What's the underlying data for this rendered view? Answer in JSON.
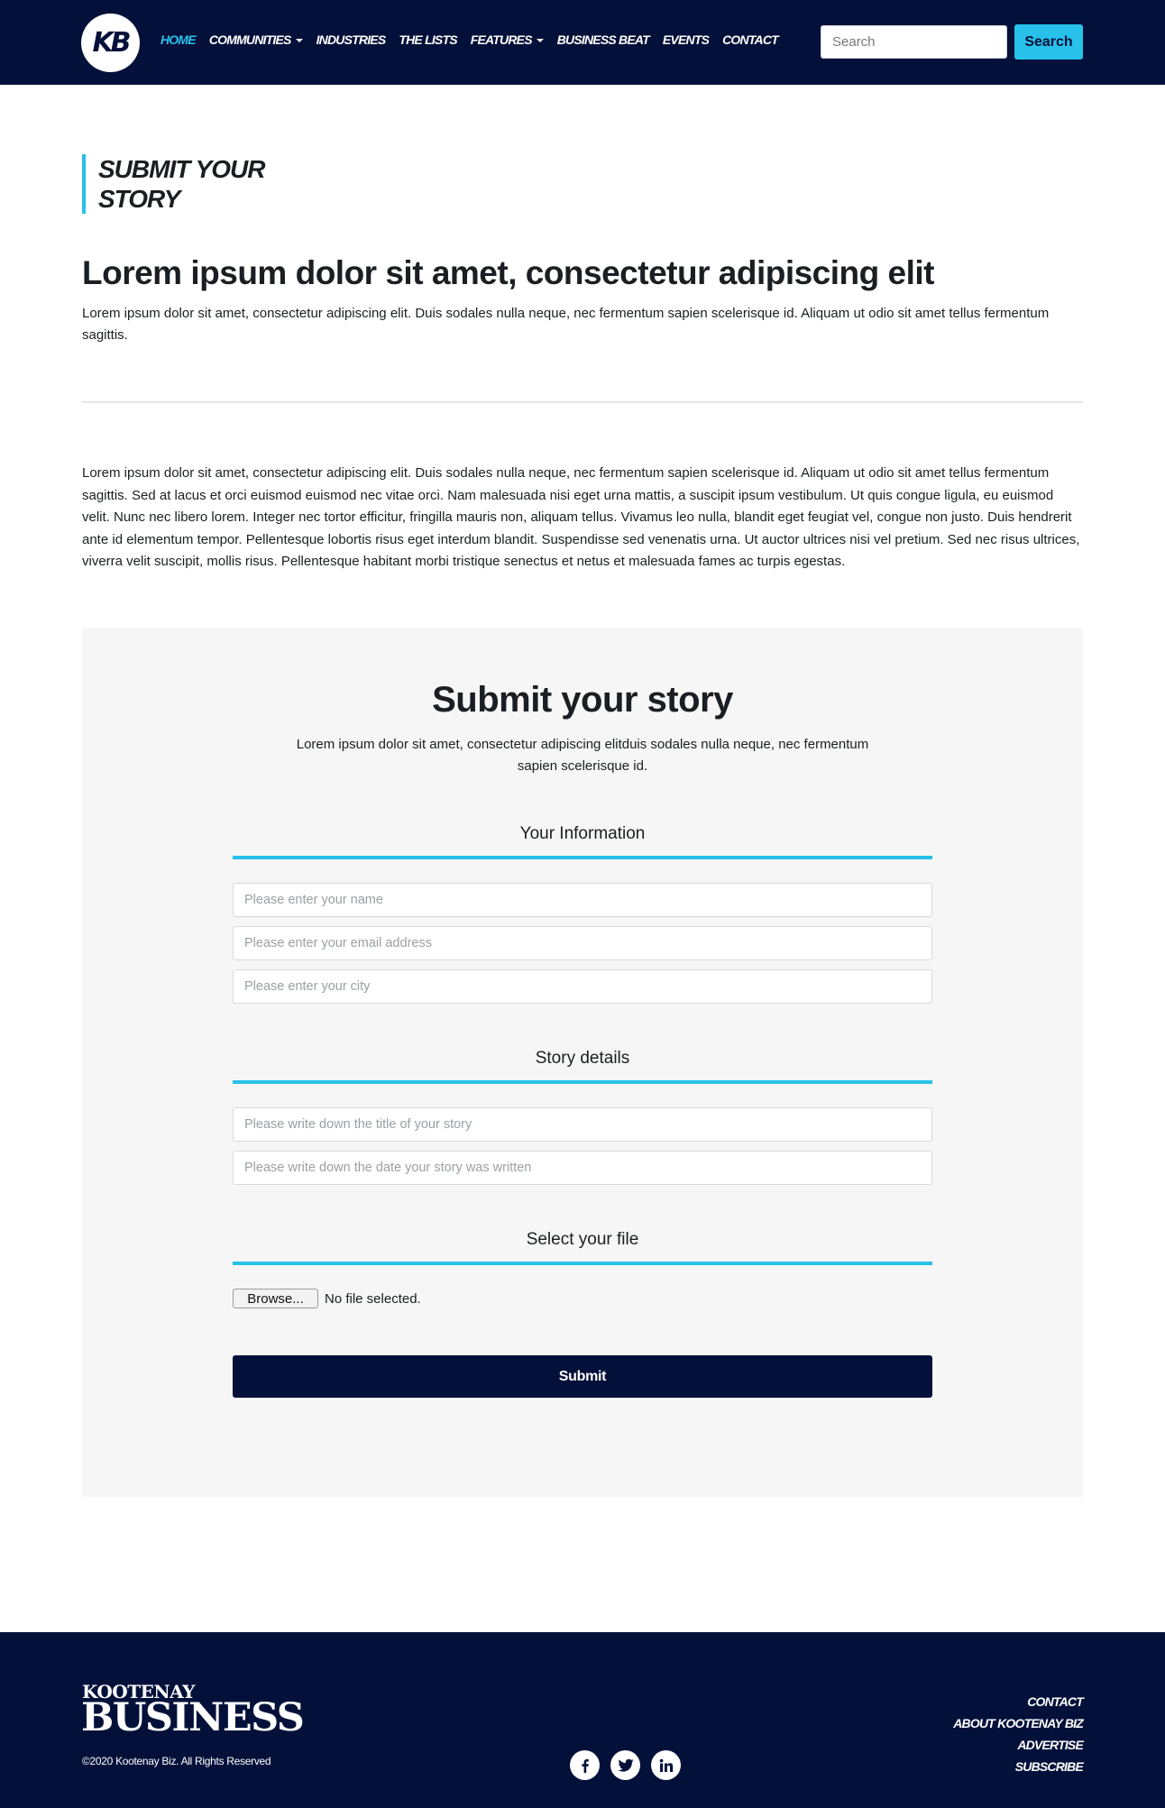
{
  "header": {
    "logo_text": "KB",
    "nav": [
      {
        "label": "HOME",
        "active": true,
        "dropdown": false
      },
      {
        "label": "COMMUNITIES",
        "active": false,
        "dropdown": true
      },
      {
        "label": "INDUSTRIES",
        "active": false,
        "dropdown": false
      },
      {
        "label": "THE LISTS",
        "active": false,
        "dropdown": false
      },
      {
        "label": "FEATURES",
        "active": false,
        "dropdown": true
      },
      {
        "label": "BUSINESS BEAT",
        "active": false,
        "dropdown": false
      },
      {
        "label": "EVENTS",
        "active": false,
        "dropdown": false
      },
      {
        "label": "CONTACT",
        "active": false,
        "dropdown": false
      }
    ],
    "search_placeholder": "Search",
    "search_button": "Search"
  },
  "page": {
    "section_heading_line1": "SUBMIT YOUR",
    "section_heading_line2": "STORY",
    "lead_title": "Lorem ipsum dolor sit amet, consectetur adipiscing elit",
    "lead_text": "Lorem ipsum dolor sit amet, consectetur adipiscing elit. Duis sodales nulla neque, nec fermentum sapien scelerisque id. Aliquam ut odio sit amet tellus fermentum sagittis.",
    "body_text": "Lorem ipsum dolor sit amet, consectetur adipiscing elit. Duis sodales nulla neque, nec fermentum sapien scelerisque id. Aliquam ut odio sit amet tellus fermentum sagittis. Sed at lacus et orci euismod euismod nec vitae orci. Nam malesuada nisi eget urna mattis, a suscipit ipsum vestibulum. Ut quis congue ligula, eu euismod velit. Nunc nec libero lorem. Integer nec tortor efficitur, fringilla mauris non, aliquam tellus. Vivamus leo nulla, blandit eget feugiat vel, congue non justo. Duis hendrerit ante id elementum tempor. Pellentesque lobortis risus eget interdum blandit. Suspendisse sed venenatis urna. Ut auctor ultrices nisi vel pretium. Sed nec risus ultrices, viverra velit suscipit, mollis risus. Pellentesque habitant morbi tristique senectus et netus et malesuada fames ac turpis egestas."
  },
  "form": {
    "title": "Submit your story",
    "intro": "Lorem ipsum dolor sit amet, consectetur adipiscing elitduis sodales nulla neque, nec fermentum sapien scelerisque id.",
    "section_info": "Your Information",
    "name_placeholder": "Please enter your name",
    "email_placeholder": "Please enter your email address",
    "city_placeholder": "Please enter your city",
    "section_story": "Story details",
    "story_title_placeholder": "Please write down the title of your story",
    "story_date_placeholder": "Please write down the date your story was written",
    "section_file": "Select your file",
    "browse_label": "Browse...",
    "file_status": "No file selected.",
    "submit_label": "Submit"
  },
  "footer": {
    "brand_top": "KOOTENAY",
    "brand_main": "BUSINESS",
    "copyright": "©2020 Kootenay Biz. All Rights Reserved",
    "socials": [
      "facebook-icon",
      "twitter-icon",
      "linkedin-icon"
    ],
    "links": [
      "CONTACT",
      "ABOUT KOOTENAY BIZ",
      "ADVERTISE",
      "SUBSCRIBE"
    ]
  },
  "colors": {
    "navy": "#03113a",
    "accent": "#27c1ea",
    "card_bg": "#f6f6f6"
  }
}
